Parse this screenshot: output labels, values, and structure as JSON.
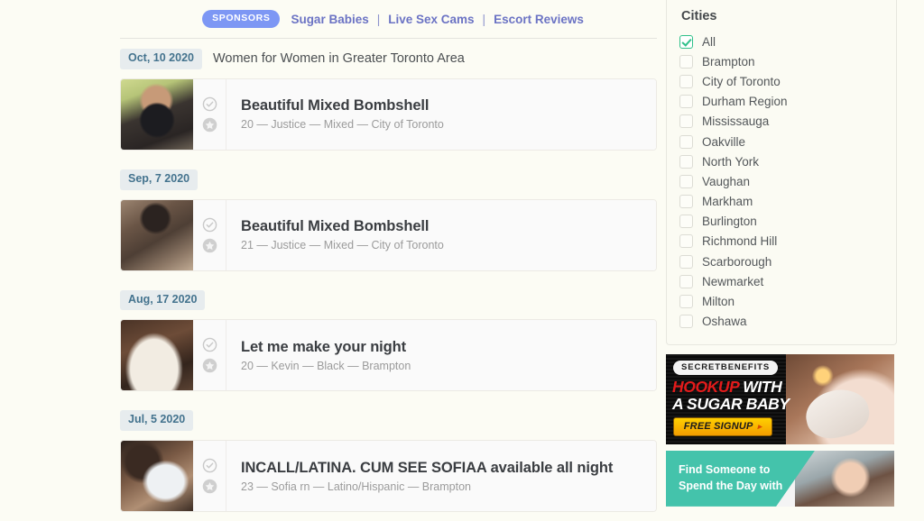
{
  "sponsors": {
    "badge_label": "SPONSORS",
    "separator": "|",
    "links": [
      {
        "label": "Sugar Babies"
      },
      {
        "label": "Live Sex Cams"
      },
      {
        "label": "Escort Reviews"
      }
    ]
  },
  "feed": [
    {
      "date": "Oct, 10 2020",
      "caption": "Women for Women in Greater Toronto Area",
      "listing": {
        "title": "Beautiful Mixed Bombshell",
        "meta": "20 — Justice — Mixed — City of Toronto",
        "verified_icon": "check-circle-icon",
        "featured_icon": "star-circle-icon"
      }
    },
    {
      "date": "Sep, 7 2020",
      "caption": "",
      "listing": {
        "title": "Beautiful Mixed Bombshell",
        "meta": "21 — Justice — Mixed — City of Toronto",
        "verified_icon": "check-circle-icon",
        "featured_icon": "star-circle-icon"
      }
    },
    {
      "date": "Aug, 17 2020",
      "caption": "",
      "listing": {
        "title": "Let me make your night",
        "meta": "20 — Kevin — Black — Brampton",
        "verified_icon": "check-circle-icon",
        "featured_icon": "star-circle-icon"
      }
    },
    {
      "date": "Jul, 5 2020",
      "caption": "",
      "listing": {
        "title": "INCALL/LATINA. CUM SEE SOFIAA available all night",
        "meta": "23 — Sofia rn — Latino/Hispanic — Brampton",
        "verified_icon": "check-circle-icon",
        "featured_icon": "star-circle-icon"
      }
    }
  ],
  "sidebar": {
    "cities_title": "Cities",
    "cities": [
      {
        "label": "All",
        "checked": true
      },
      {
        "label": "Brampton",
        "checked": false
      },
      {
        "label": "City of Toronto",
        "checked": false
      },
      {
        "label": "Durham Region",
        "checked": false
      },
      {
        "label": "Mississauga",
        "checked": false
      },
      {
        "label": "Oakville",
        "checked": false
      },
      {
        "label": "North York",
        "checked": false
      },
      {
        "label": "Vaughan",
        "checked": false
      },
      {
        "label": "Markham",
        "checked": false
      },
      {
        "label": "Burlington",
        "checked": false
      },
      {
        "label": "Richmond Hill",
        "checked": false
      },
      {
        "label": "Scarborough",
        "checked": false
      },
      {
        "label": "Newmarket",
        "checked": false
      },
      {
        "label": "Milton",
        "checked": false
      },
      {
        "label": "Oshawa",
        "checked": false
      }
    ],
    "ads": [
      {
        "brand": "SECRETBENEFITS",
        "line1_highlight": "HOOKUP",
        "line1_rest": " WITH",
        "line2": "A SUGAR BABY",
        "cta": "FREE SIGNUP",
        "cta_arrow": "▸"
      },
      {
        "line1": "Find Someone to",
        "line2": "Spend the Day with"
      }
    ]
  },
  "colors": {
    "page_background": "#fcfcf4",
    "sponsors_badge": "#7d97f4",
    "sponsor_link": "#6b73c4",
    "date_badge_bg": "#e7ecee",
    "date_badge_text": "#44738e",
    "checkbox_checked": "#2fc08a",
    "listing_card_bg": "#fafafa",
    "ad_teal": "#44c3ab",
    "ad_red": "#e31b1b",
    "ad_cta_yellow": "#f39c00"
  }
}
